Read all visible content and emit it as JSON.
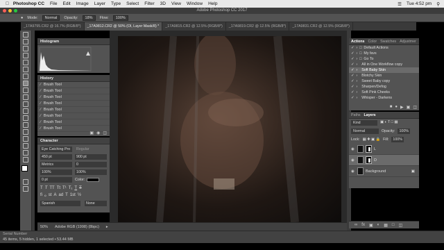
{
  "macbar": {
    "app": "Photoshop CC",
    "menu": [
      "File",
      "Edit",
      "Image",
      "Layer",
      "Type",
      "Select",
      "Filter",
      "3D",
      "View",
      "Window",
      "Help"
    ],
    "clock": "Tue 4:52 pm"
  },
  "window_title": "Adobe Photoshop CC 2017",
  "options": {
    "mode_label": "Mode:",
    "mode_value": "Normal",
    "opacity_label": "Opacity:",
    "opacity_value": "18%",
    "flow_label": "Flow:",
    "flow_value": "100%"
  },
  "tabs": [
    "_17A9795.CR2 @ 16.7% (RGB/8*)",
    "_17A9812.CR2 @ 50% (Ol, Layer Mask/8) *",
    "_17A9815.CR2 @ 12.5% (RGB/8*)",
    "_17A9819.CR2 @ 12.5% (RGB/8*)",
    "_17A9831.CR2 @ 12.5% (RGB/8*)"
  ],
  "histogram": {
    "title": "Histogram"
  },
  "history": {
    "title": "History",
    "items": [
      "Brush Tool",
      "Brush Tool",
      "Brush Tool",
      "Brush Tool",
      "Brush Tool",
      "Brush Tool",
      "Brush Tool",
      "Brush Tool"
    ]
  },
  "character": {
    "title": "Character",
    "font": "Eye Catching Pro",
    "style": "Regular",
    "size": "450 pt",
    "leading": "900 pt",
    "kerning": "Metrics",
    "tracking": "0",
    "vscale": "100%",
    "hscale": "100%",
    "baseline": "0 pt",
    "color_label": "Color:",
    "language": "Spanish",
    "aa": "None"
  },
  "statusbar": {
    "zoom": "50%",
    "profile": "Adobe RGB (1998) (8bpc)",
    "bottom_label": "Serial Number",
    "items_info": "45 items, 5 hidden, 1 selected • 53.44 MB"
  },
  "actions": {
    "tabs": [
      "Actions",
      "Color",
      "Swatches",
      "Adjustmer"
    ],
    "items": [
      {
        "label": "Default Actions",
        "selected": false
      },
      {
        "label": "My favs",
        "selected": false
      },
      {
        "label": "Go To",
        "selected": false
      },
      {
        "label": "All in One Workflow copy",
        "selected": false
      },
      {
        "label": "Soft Baby Skin",
        "selected": true
      },
      {
        "label": "Blotchy Skin",
        "selected": false
      },
      {
        "label": "Sweet Baby copy",
        "selected": false
      },
      {
        "label": "Sharpen/Defog",
        "selected": false
      },
      {
        "label": "Soft Pink Cheeks",
        "selected": false
      },
      {
        "label": "Whisper - Darkens",
        "selected": false
      }
    ]
  },
  "layers": {
    "tabs": [
      "Paths",
      "Layers"
    ],
    "kind_label": "Kind",
    "blend_mode": "Normal",
    "opacity_label": "Opacity:",
    "opacity_value": "100%",
    "lock_label": "Lock:",
    "fill_label": "Fill:",
    "fill_value": "100%",
    "items": [
      {
        "name": "L",
        "selected": false,
        "has_mask": true
      },
      {
        "name": "D",
        "selected": true,
        "has_mask": true
      },
      {
        "name": "Background",
        "selected": false,
        "has_mask": false
      }
    ]
  },
  "colors": {
    "accent_selected": "#6b6b6b",
    "panel_bg": "#535353",
    "canvas_bg": "#2a2a2a"
  }
}
